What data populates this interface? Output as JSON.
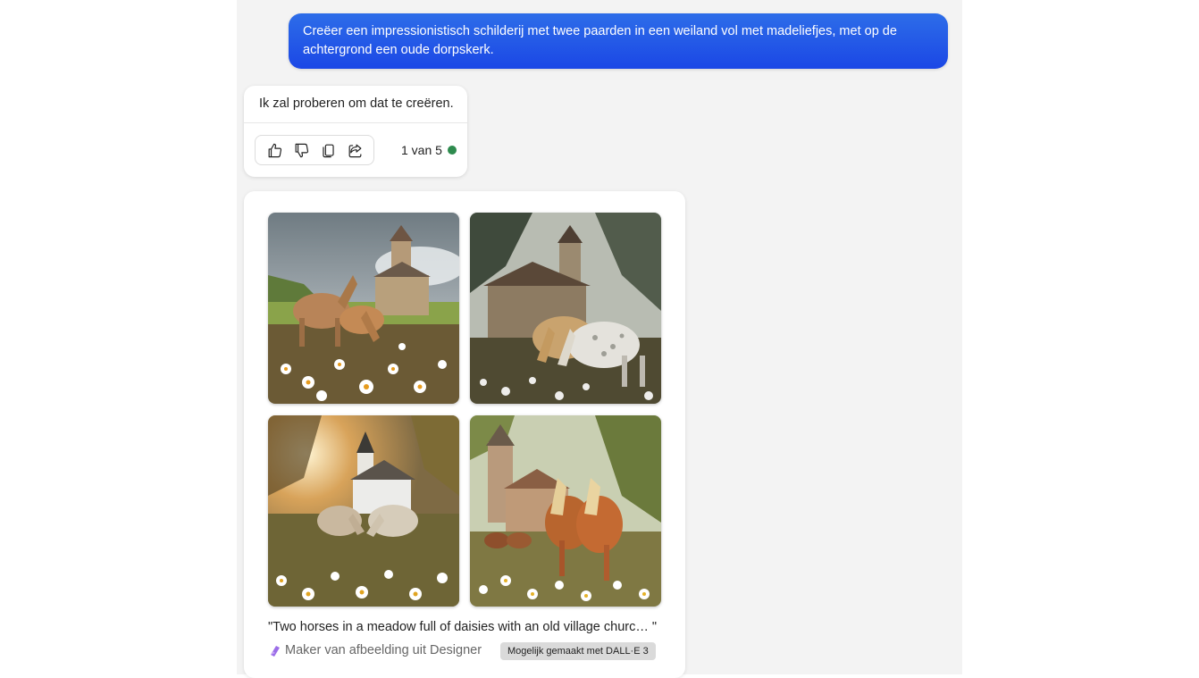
{
  "user_message": {
    "text": "Creëer een impressionistisch schilderij met twee paarden in een weiland vol met madeliefjes, met op de achtergrond een oude dorpskerk."
  },
  "bot_message": {
    "text": "Ik zal proberen om dat te creëren.",
    "actions": [
      {
        "name": "like",
        "icon": "thumbs-up-icon"
      },
      {
        "name": "dislike",
        "icon": "thumbs-down-icon"
      },
      {
        "name": "copy",
        "icon": "copy-icon"
      },
      {
        "name": "share",
        "icon": "share-icon"
      }
    ],
    "counter": "1 van 5",
    "status_color": "#2e8b4e"
  },
  "image_result": {
    "images": [
      {
        "scene": "horses-church-meadow"
      },
      {
        "scene": "horses-church-forest"
      },
      {
        "scene": "horses-church-sunset"
      },
      {
        "scene": "horses-church-village"
      }
    ],
    "caption": "\"Two horses in a meadow full of daisies with an old village churc… \"",
    "maker_label": "Maker van afbeelding uit Designer",
    "badge": "Mogelijk gemaakt met DALL·E 3"
  },
  "colors": {
    "user_bubble": "#1b47e6",
    "background": "#f3f3f3"
  }
}
